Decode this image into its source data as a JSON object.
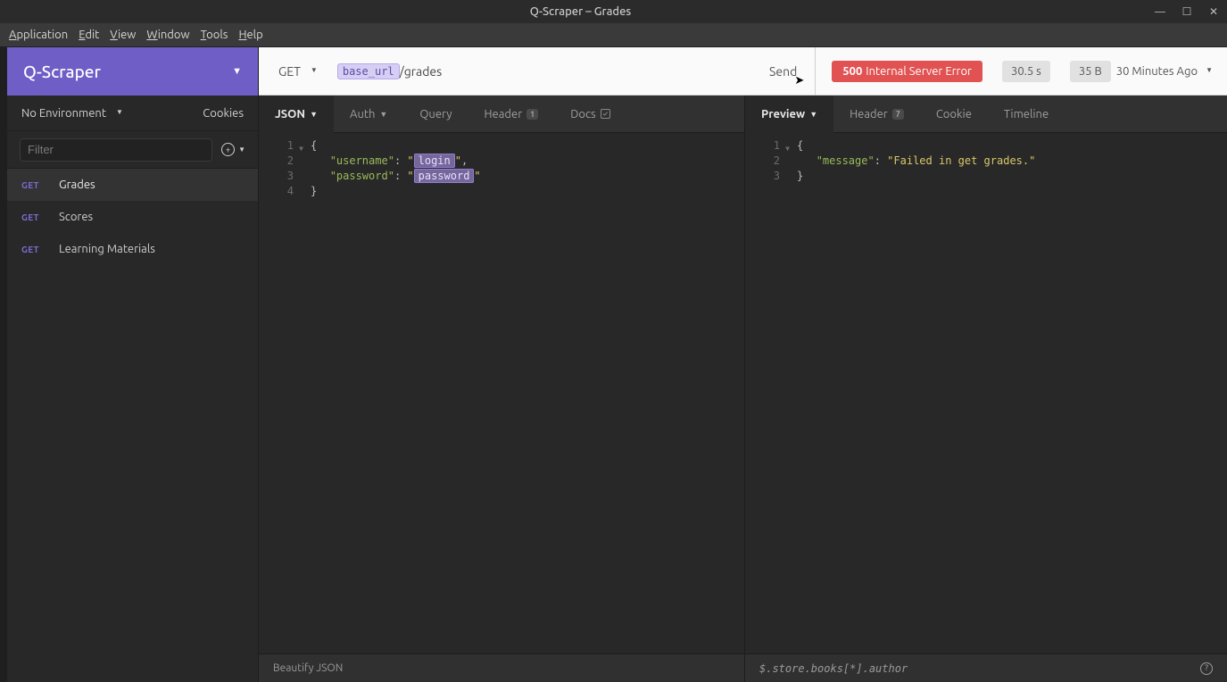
{
  "window": {
    "title": "Q-Scraper – Grades"
  },
  "menus": [
    "Application",
    "Edit",
    "View",
    "Window",
    "Tools",
    "Help"
  ],
  "workspace": {
    "name": "Q-Scraper"
  },
  "env": {
    "label": "No Environment",
    "cookies": "Cookies"
  },
  "filter": {
    "placeholder": "Filter"
  },
  "requests": [
    {
      "method": "GET",
      "name": "Grades",
      "active": true
    },
    {
      "method": "GET",
      "name": "Scores",
      "active": false
    },
    {
      "method": "GET",
      "name": "Learning Materials",
      "active": false
    }
  ],
  "urlbar": {
    "method": "GET",
    "var": "base_url",
    "path": "/grades",
    "send": "Send"
  },
  "response": {
    "status_code": "500",
    "status_text": "Internal Server Error",
    "time": "30.5 s",
    "size": "35 B",
    "ago": "30 Minutes Ago"
  },
  "req_tabs": {
    "json": "JSON",
    "auth": "Auth",
    "query": "Query",
    "header": "Header",
    "header_badge": "1",
    "docs": "Docs"
  },
  "res_tabs": {
    "preview": "Preview",
    "header": "Header",
    "header_badge": "7",
    "cookie": "Cookie",
    "timeline": "Timeline"
  },
  "req_body": {
    "l1": "{",
    "k_user": "\"username\"",
    "k_pass": "\"password\"",
    "var_login": "login",
    "var_password": "password",
    "l4": "}"
  },
  "res_body": {
    "l1": "{",
    "k_msg": "\"message\"",
    "v_msg": "\"Failed in get grades.\"",
    "l3": "}"
  },
  "footer": {
    "left": "Beautify JSON",
    "right": "$.store.books[*].author"
  }
}
